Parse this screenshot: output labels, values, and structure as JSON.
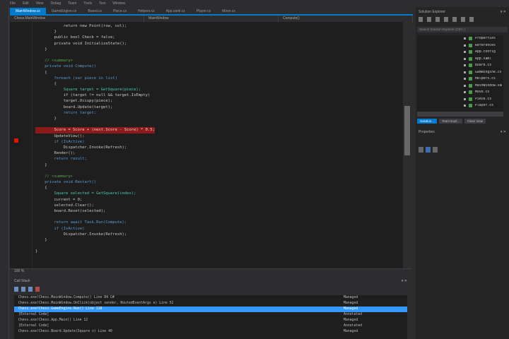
{
  "menubar": {
    "items": [
      "File",
      "Edit",
      "View",
      "Debug",
      "Team",
      "Tools",
      "Test",
      "Window"
    ]
  },
  "tabs": [
    {
      "label": "MainWindow.cs",
      "active": true
    },
    {
      "label": "GameEngine.cs"
    },
    {
      "label": "Board.cs"
    },
    {
      "label": "Piece.cs"
    },
    {
      "label": "Helpers.cs"
    },
    {
      "label": "App.xaml.cs"
    },
    {
      "label": "Player.cs"
    },
    {
      "label": "Move.cs"
    }
  ],
  "navbar": {
    "project": "Chess.MainWindow",
    "class": "MainWindow",
    "member": "Compute()"
  },
  "code": [
    {
      "t": "            return new Point(row, col);"
    },
    {
      "t": "        }"
    },
    {
      "t": "        public bool Check = false;"
    },
    {
      "t": "        private void InitializeState();"
    },
    {
      "t": "    }"
    },
    {
      "t": ""
    },
    {
      "t": "    // <summary>",
      "c": "cm"
    },
    {
      "t": "    private void Compute()",
      "c": "kw"
    },
    {
      "t": "    {"
    },
    {
      "t": "        foreach (var piece in list)",
      "c": "kw"
    },
    {
      "t": "        {"
    },
    {
      "t": "            Square target = GetSquare(piece);",
      "c": "ty"
    },
    {
      "t": "            if (target != null && target.IsEmpty)"
    },
    {
      "t": "            target.Occupy(piece);"
    },
    {
      "t": "            board.Update(target);"
    },
    {
      "t": "            return target;",
      "c": "kw"
    },
    {
      "t": "        }"
    },
    {
      "t": ""
    },
    {
      "t": "        Score = Score + (next.Score - Score) * 0.5;",
      "c": "hl"
    },
    {
      "t": "        UpdateView();"
    },
    {
      "t": "        if (IsActive)",
      "c": "kw"
    },
    {
      "t": "            Dispatcher.Invoke(Refresh);"
    },
    {
      "t": "        Render();"
    },
    {
      "t": "        return result;",
      "c": "kw"
    },
    {
      "t": "    }"
    },
    {
      "t": ""
    },
    {
      "t": "    // <summary>",
      "c": "cm"
    },
    {
      "t": "    private void Restart()",
      "c": "kw"
    },
    {
      "t": "    {"
    },
    {
      "t": "        Square selected = GetSquare(index);",
      "c": "ty"
    },
    {
      "t": "        current = 0;"
    },
    {
      "t": "        selected.Clear();"
    },
    {
      "t": "        board.Reset(selected);"
    },
    {
      "t": ""
    },
    {
      "t": "        return await Task.Run(Compute);",
      "c": "kw"
    },
    {
      "t": "        if (IsActive)",
      "c": "kw"
    },
    {
      "t": "            Dispatcher.Invoke(Refresh);"
    },
    {
      "t": "    }"
    },
    {
      "t": ""
    },
    {
      "t": "}"
    }
  ],
  "zoom": "100 %",
  "output": {
    "title": "Call Stack",
    "pin": "▾ ✕",
    "rows": [
      {
        "a": "Chess.exe!Chess.MainWindow.Compute() Line 84 C#",
        "b": "Managed"
      },
      {
        "a": "Chess.exe!Chess.MainWindow.OnClick(object sender, RoutedEventArgs e) Line 52",
        "b": "Managed"
      },
      {
        "a": "Chess.exe!Chess.GameEngine.Run() Line 118",
        "b": "Managed",
        "sel": true
      },
      {
        "a": "[External Code]",
        "b": "Annotated"
      },
      {
        "a": "Chess.exe!Chess.App.Main() Line 12",
        "b": "Managed"
      },
      {
        "a": "[External Code]",
        "b": "Annotated"
      },
      {
        "a": "Chess.exe!Chess.Board.Update(Square s) Line 40",
        "b": "Managed"
      }
    ]
  },
  "solution": {
    "title": "Solution Explorer",
    "pin": "▾ ✕",
    "search": "Search Solution Explorer (Ctrl+;)",
    "items": [
      "Properties",
      "References",
      "App.config",
      "App.xaml",
      "Board.cs",
      "GameEngine.cs",
      "Helpers.cs",
      "MainWindow.xaml",
      "Move.cs",
      "Piece.cs",
      "Player.cs"
    ],
    "tabs": [
      "Solution...",
      "Team Expl...",
      "Class View"
    ]
  },
  "properties": {
    "title": "Properties",
    "pin": "▾ ✕"
  }
}
